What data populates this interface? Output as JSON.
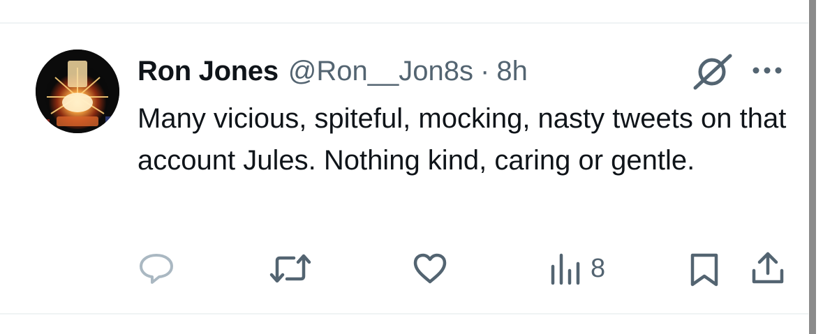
{
  "tweet": {
    "display_name": "Ron Jones",
    "handle": "@Ron__Jon8s",
    "separator": "·",
    "time": "8h",
    "text": "Many vicious, spiteful, mocking, nasty tweets on that account Jules. Nothing kind, caring or gentle.",
    "avatar": {
      "description_icon": "avatar-illuminated-badge"
    }
  },
  "actions": {
    "reply": {
      "icon": "reply-icon"
    },
    "retweet": {
      "icon": "retweet-icon"
    },
    "like": {
      "icon": "heart-icon"
    },
    "views": {
      "icon": "views-bar-chart-icon",
      "count": "8"
    },
    "bookmark": {
      "icon": "bookmark-icon"
    },
    "share": {
      "icon": "share-icon"
    }
  },
  "header_icons": {
    "grok": "grok-icon",
    "more": "more-icon"
  },
  "colors": {
    "text_primary": "#0f1419",
    "text_secondary": "#536471",
    "divider": "#eff3f4",
    "reply_icon": "#aab8c2"
  }
}
